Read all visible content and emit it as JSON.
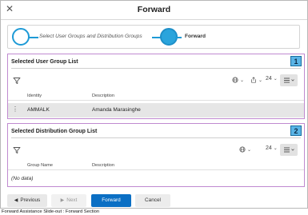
{
  "header": {
    "title": "Forward",
    "close_icon": "close-icon"
  },
  "stepper": {
    "step1_label": "Select User Groups and Distribution Groups",
    "step2_label": "Forward"
  },
  "section_user": {
    "title": "Selected User Group List",
    "badge": "1",
    "page_size": "24",
    "columns": [
      "Identity",
      "Description"
    ],
    "rows": [
      {
        "identity": "AMMALK",
        "description": "Amanda Marasinghe"
      }
    ]
  },
  "section_dist": {
    "title": "Selected Distribution Group List",
    "badge": "2",
    "page_size": "24",
    "columns": [
      "Group Name",
      "Description"
    ],
    "empty_text": "(No data)"
  },
  "footer": {
    "previous_label": "Previous",
    "next_label": "Next",
    "forward_label": "Forward",
    "cancel_label": "Cancel"
  },
  "caption": "Forward Assistance Slide-out : Forward Section",
  "colors": {
    "primary": "#0b6fc4",
    "step_accent": "#1e9ad6",
    "section_border": "#c08ad0",
    "badge": "#5ab4e6"
  }
}
